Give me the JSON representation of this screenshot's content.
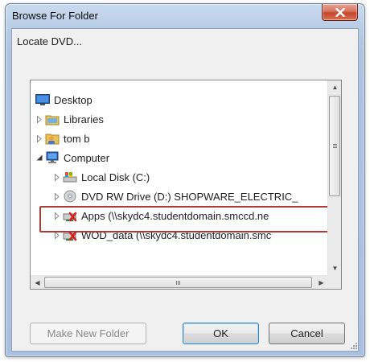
{
  "window": {
    "title": "Browse For Folder"
  },
  "dialog": {
    "prompt": "Locate DVD..."
  },
  "tree": {
    "items": [
      {
        "label": "Desktop",
        "icon": "desktop-icon",
        "expander": "none",
        "indent": 0
      },
      {
        "label": "Libraries",
        "icon": "libraries-icon",
        "expander": "collapsed",
        "indent": 1
      },
      {
        "label": "tom b",
        "icon": "user-folder-icon",
        "expander": "collapsed",
        "indent": 1
      },
      {
        "label": "Computer",
        "icon": "computer-icon",
        "expander": "expanded",
        "indent": 1
      },
      {
        "label": "Local Disk (C:)",
        "icon": "local-disk-icon",
        "expander": "collapsed",
        "indent": 2
      },
      {
        "label": "DVD RW Drive (D:) SHOPWARE_ELECTRIC_",
        "icon": "dvd-drive-icon",
        "expander": "collapsed",
        "indent": 2,
        "highlighted": true
      },
      {
        "label": "Apps (\\\\skydc4.studentdomain.smccd.ne",
        "icon": "network-drive-disconnected-icon",
        "expander": "collapsed",
        "indent": 2
      },
      {
        "label": "WOD_data (\\\\skydc4.studentdomain.smc",
        "icon": "network-drive-disconnected-icon",
        "expander": "collapsed",
        "indent": 2
      }
    ]
  },
  "buttons": {
    "make_new_folder": "Make New Folder",
    "ok": "OK",
    "cancel": "Cancel"
  },
  "colors": {
    "highlight": "#b23a35",
    "close_button": "#c5452c"
  }
}
